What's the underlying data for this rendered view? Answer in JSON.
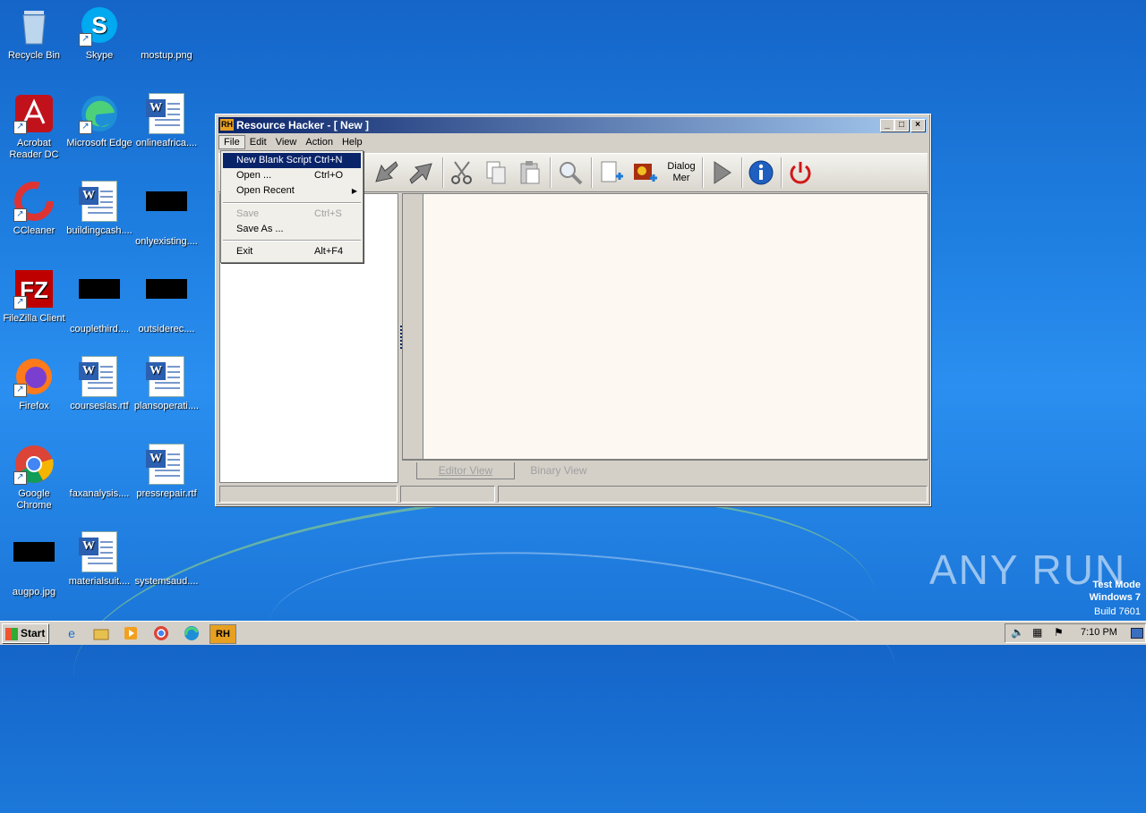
{
  "desktop": {
    "icons": [
      {
        "label": "Recycle Bin"
      },
      {
        "label": "Skype"
      },
      {
        "label": "mostup.png"
      },
      {
        "label": "Acrobat Reader DC"
      },
      {
        "label": "Microsoft Edge"
      },
      {
        "label": "onlineafrica...."
      },
      {
        "label": "CCleaner"
      },
      {
        "label": "buildingcash...."
      },
      {
        "label": "onlyexisting...."
      },
      {
        "label": "FileZilla Client"
      },
      {
        "label": "couplethird...."
      },
      {
        "label": "outsiderec...."
      },
      {
        "label": "Firefox"
      },
      {
        "label": "courseslas.rtf"
      },
      {
        "label": "plansoperati...."
      },
      {
        "label": "Google Chrome"
      },
      {
        "label": "faxanalysis...."
      },
      {
        "label": "pressrepair.rtf"
      },
      {
        "label": "augpo.jpg"
      },
      {
        "label": "materialsuit...."
      },
      {
        "label": "systemsaud...."
      }
    ],
    "watermark": {
      "line1": "Test Mode",
      "line2": "Windows 7",
      "line3": "Build 7601"
    },
    "brand": "ANY RUN"
  },
  "window": {
    "title": "Resource Hacker - [ New ]",
    "app_icon": "RH",
    "controls": {
      "minimize": "_",
      "maximize": "□",
      "close": "×"
    },
    "menu": [
      "File",
      "Edit",
      "View",
      "Action",
      "Help"
    ],
    "tabs": {
      "editor": "Editor View",
      "binary": "Binary View"
    },
    "toolbar": {
      "dialog_label_1": "Dialog",
      "dialog_label_2": "Mer"
    }
  },
  "file_menu": {
    "items": [
      {
        "label": "New Blank Script",
        "shortcut": "Ctrl+N"
      },
      {
        "label": "Open ...",
        "shortcut": "Ctrl+O"
      },
      {
        "label": "Open Recent",
        "shortcut": ""
      },
      {
        "label": "Save",
        "shortcut": "Ctrl+S"
      },
      {
        "label": "Save As ...",
        "shortcut": ""
      },
      {
        "label": "Exit",
        "shortcut": "Alt+F4"
      }
    ]
  },
  "taskbar": {
    "start_label": "Start",
    "clock": "7:10 PM",
    "running_app": "RH"
  },
  "colors": {
    "titlebar": "#0a246a",
    "desktop": "#1e7ee0",
    "highlight": "#0a246a"
  }
}
